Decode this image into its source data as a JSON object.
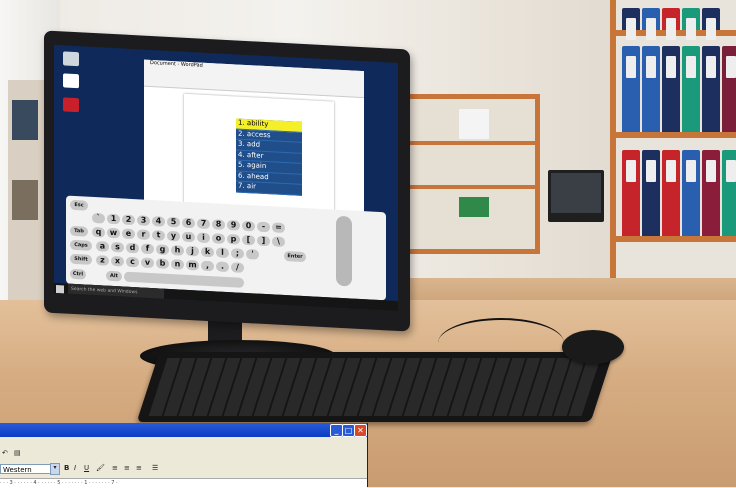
{
  "word": {
    "title": "Document - WordPad",
    "suggestions": [
      "1. ability",
      "2. access",
      "3. add",
      "4. after",
      "5. again",
      "6. ahead",
      "7. air"
    ]
  },
  "osk": {
    "rows": [
      [
        "`",
        "1",
        "2",
        "3",
        "4",
        "5",
        "6",
        "7",
        "8",
        "9",
        "0",
        "-",
        "="
      ],
      [
        "q",
        "w",
        "e",
        "r",
        "t",
        "y",
        "u",
        "i",
        "o",
        "p",
        "[",
        "]",
        "\\"
      ],
      [
        "a",
        "s",
        "d",
        "f",
        "g",
        "h",
        "j",
        "k",
        "l",
        ";",
        "'"
      ],
      [
        "z",
        "x",
        "c",
        "v",
        "b",
        "n",
        "m",
        ",",
        ".",
        "/"
      ]
    ],
    "special": {
      "esc": "Esc",
      "tab": "Tab",
      "caps": "Caps",
      "shift": "Shift",
      "ctrl": "Ctrl",
      "alt": "Alt",
      "enter": "Enter"
    }
  },
  "taskbar": {
    "search_placeholder": "Search the web and Windows"
  },
  "classic_window": {
    "font_value": "Western",
    "format_buttons": [
      "B",
      "I",
      "U"
    ],
    "ruler": "· · · 3 · · · · · · 4 · · · · · · 5 · · · · · · · 1 · · · · · · · 7 ·"
  },
  "colors": {
    "suggestion_highlight": "#f5ef2a",
    "suggestion_bg": "#1f4e8a",
    "title_bar": "#0a3cc5"
  }
}
